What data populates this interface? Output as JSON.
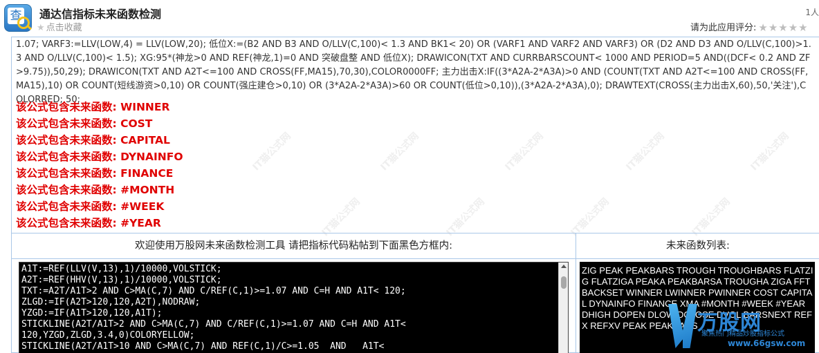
{
  "header": {
    "title": "通达信指标未来函数检测",
    "favorite_label": "点击收藏",
    "users_count": "1人",
    "rating_label": "请为此应用评分:",
    "icon_glyph": "查"
  },
  "code_display": "1.07; VARF3:=LLV(LOW,4) = LLV(LOW,20); 低位X:=(B2 AND B3 AND O/LLV(C,100)< 1.3 AND BK1< 20) OR (VARF1 AND VARF2 AND VARF3) OR (D2 AND D3 AND O/LLV(C,100)>1.3 AND O/LLV(C,100)< 1.5); XG:95*(神龙>0 AND REF(神龙,1)=0 AND 突破盘整 AND 低位X); DRAWICON(TXT AND CURRBARSCOUNT< 1000 AND PERIOD=5 AND((DCF< 0.2 AND ZF>9.75)),50,29); DRAWICON(TXT AND A2T<=100 AND CROSS(FF,MA15),70,30),COLOR0000FF; 主力出击X:IF((3*A2A-2*A3A)>0 AND (COUNT(TXT AND A2T<=100 AND CROSS(FF,MA15),10) OR COUNT(短线游资>0,10) OR COUNT(强庄建仓>0,10) OR (3*A2A-2*A3A)>60 OR COUNT(低位>0,10)),(3*A2A-2*A3A),0); DRAWTEXT(CROSS(主力出击X,60),50,'关注'),COLORRED; 50;",
  "warnings": [
    "该公式包含未来函数: WINNER",
    "该公式包含未来函数: COST",
    "该公式包含未来函数: CAPITAL",
    "该公式包含未来函数: DYNAINFO",
    "该公式包含未来函数: FINANCE",
    "该公式包含未来函数: #MONTH",
    "该公式包含未来函数: #WEEK",
    "该公式包含未来函数: #YEAR"
  ],
  "tool": {
    "left_header": "欢迎使用万股网未来函数检测工具 请把指标代码粘帖到下面黑色方框内:",
    "right_header": "未来函数列表:",
    "editor_content": "A1T:=REF(LLV(V,13),1)/10000,VOLSTICK;\nA2T:=REF(HHV(V,13),1)/10000,VOLSTICK;\nTXT:=A2T/A1T>2 AND C>MA(C,7) AND C/REF(C,1)>=1.07 AND C=H AND A1T< 120;\nZLGD:=IF(A2T>120,120,A2T),NODRAW;\nYZGD:=IF(A1T>120,120,A1T);\nSTICKLINE(A2T/A1T>2 AND C>MA(C,7) AND C/REF(C,1)>=1.07 AND C=H AND A1T<\n120,YZGD,ZLGD,3.4,0)COLORYELLOW;\nSTICKLINE(A2T/A1T>10 AND C>MA(C,7) AND REF(C,1)/C>=1.05  AND   A1T<",
    "future_functions": "ZIG PEAK PEAKBARS TROUGH TROUGHBARS FLATZIG FLATZIGA PEAKA PEAKBARSA TROUGHA ZIGA FFT BACKSET WINNER LWINNER PWINNER COST CAPITAL DYNAINFO FINANCE XMA #MONTH #WEEK #YEAR DHIGH DOPEN DLOW DCLOSE DVOL BARSNEXT REFX REFXV PEAK PEAKBARS"
  },
  "watermark_text": "IT猫公式网",
  "corner": {
    "brand": "万股网",
    "tagline": "聚焦热门精品炒股指标公式",
    "url": "www.66gsw.com"
  },
  "colors": {
    "warning": "#e00000",
    "border": "#a9c7e8",
    "editor_bg": "#000000",
    "brand_blue": "#2d86d6"
  }
}
